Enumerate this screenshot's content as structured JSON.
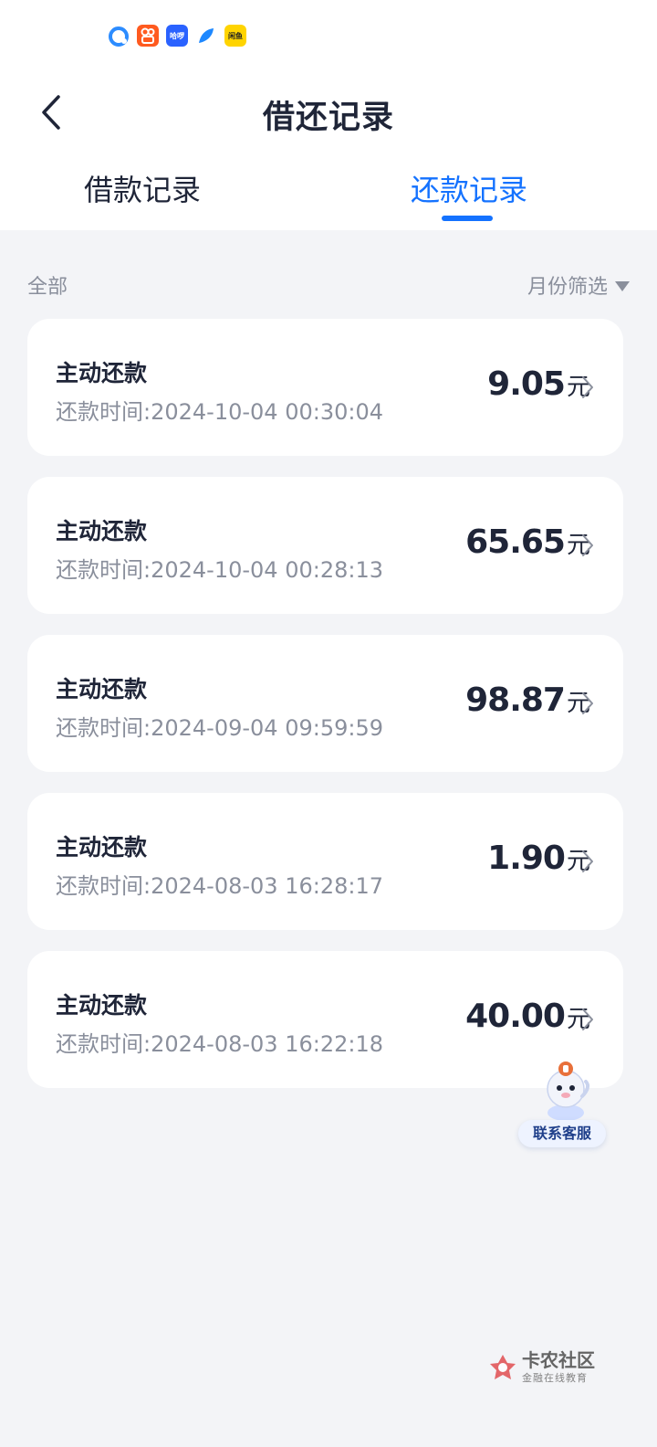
{
  "status_bar": {
    "icons": [
      {
        "name": "cloud-app-icon",
        "label": ""
      },
      {
        "name": "kuaishou-app-icon",
        "label": ""
      },
      {
        "name": "hello-app-icon",
        "label": "哈啰"
      },
      {
        "name": "feather-app-icon",
        "label": ""
      },
      {
        "name": "xianyu-app-icon",
        "label": "闲鱼"
      }
    ]
  },
  "header": {
    "title": "借还记录",
    "back_icon": "chevron-left-icon"
  },
  "tabs": [
    {
      "label": "借款记录",
      "active": false
    },
    {
      "label": "还款记录",
      "active": true
    }
  ],
  "accent_color": "#1472ff",
  "filter": {
    "all_label": "全部",
    "month_label": "月份筛选"
  },
  "records": [
    {
      "type": "主动还款",
      "time": "还款时间:2024-10-04 00:30:04",
      "amount": "9.05",
      "unit": "元"
    },
    {
      "type": "主动还款",
      "time": "还款时间:2024-10-04 00:28:13",
      "amount": "65.65",
      "unit": "元"
    },
    {
      "type": "主动还款",
      "time": "还款时间:2024-09-04 09:59:59",
      "amount": "98.87",
      "unit": "元"
    },
    {
      "type": "主动还款",
      "time": "还款时间:2024-08-03 16:28:17",
      "amount": "1.90",
      "unit": "元"
    },
    {
      "type": "主动还款",
      "time": "还款时间:2024-08-03 16:22:18",
      "amount": "40.00",
      "unit": "元"
    }
  ],
  "customer_service": {
    "label": "联系客服"
  },
  "watermark": {
    "main": "卡农社区",
    "sub": "金融在线教育"
  }
}
